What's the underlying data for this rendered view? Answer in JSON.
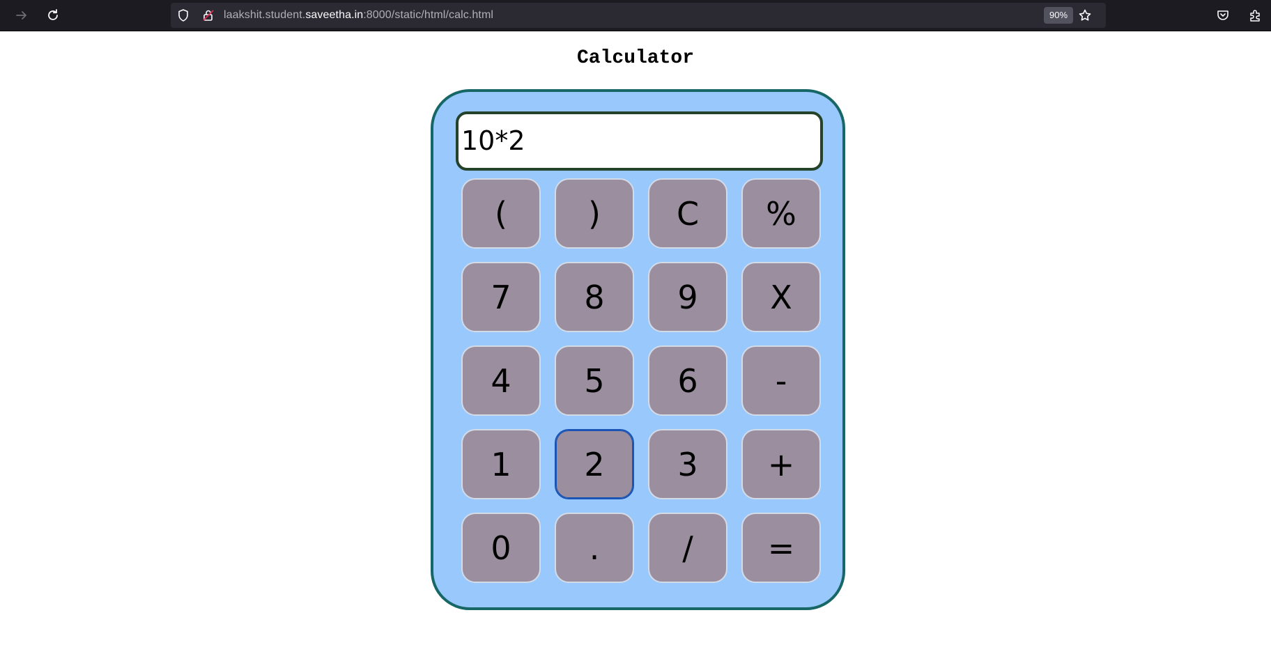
{
  "browser": {
    "url_prefix": "laakshit.student.",
    "url_host": "saveetha.in",
    "url_suffix": ":8000/static/html/calc.html",
    "zoom": "90%"
  },
  "page": {
    "title": "Calculator"
  },
  "calculator": {
    "display_value": "10*2",
    "focused_key": "2",
    "keys": [
      "(",
      ")",
      "C",
      "%",
      "7",
      "8",
      "9",
      "X",
      "4",
      "5",
      "6",
      "-",
      "1",
      "2",
      "3",
      "+",
      "0",
      ".",
      "/",
      "="
    ]
  }
}
